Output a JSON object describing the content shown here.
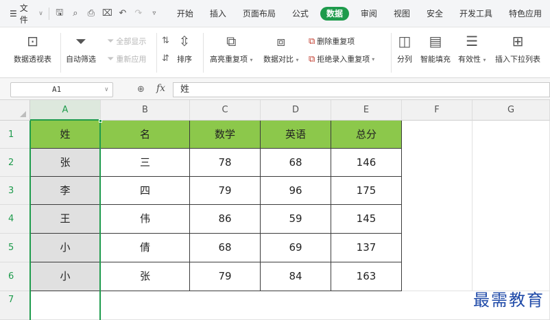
{
  "menu": {
    "file_label": "文件",
    "tabs": [
      "开始",
      "插入",
      "页面布局",
      "公式",
      "数据",
      "审阅",
      "视图",
      "安全",
      "开发工具",
      "特色应用"
    ],
    "active_tab": "数据"
  },
  "ribbon": {
    "pivot": "数据透视表",
    "autofilter": "自动筛选",
    "show_all": "全部显示",
    "reapply": "重新应用",
    "sort": "排序",
    "highlight_dup": "高亮重复项",
    "compare": "数据对比",
    "remove_dup": "删除重复项",
    "reject_dup": "拒绝录入重复项",
    "split": "分列",
    "smart_fill": "智能填充",
    "validity": "有效性",
    "dropdown": "插入下拉列表"
  },
  "formula_bar": {
    "cell_ref": "A1",
    "fx": "fx",
    "content": "姓"
  },
  "columns": [
    "A",
    "B",
    "C",
    "D",
    "E",
    "F",
    "G"
  ],
  "rows": [
    "1",
    "2",
    "3",
    "4",
    "5",
    "6",
    "7"
  ],
  "table": {
    "header": [
      "姓",
      "名",
      "数学",
      "英语",
      "总分"
    ],
    "data": [
      [
        "张",
        "三",
        "78",
        "68",
        "146"
      ],
      [
        "李",
        "四",
        "79",
        "96",
        "175"
      ],
      [
        "王",
        "伟",
        "86",
        "59",
        "145"
      ],
      [
        "小",
        "倩",
        "68",
        "69",
        "137"
      ],
      [
        "小",
        "张",
        "79",
        "84",
        "163"
      ]
    ]
  },
  "watermark": "最需教育",
  "colors": {
    "accent": "#1e9b4c",
    "header_fill": "#8cc84b",
    "column_a_fill": "#e0e0e0"
  }
}
